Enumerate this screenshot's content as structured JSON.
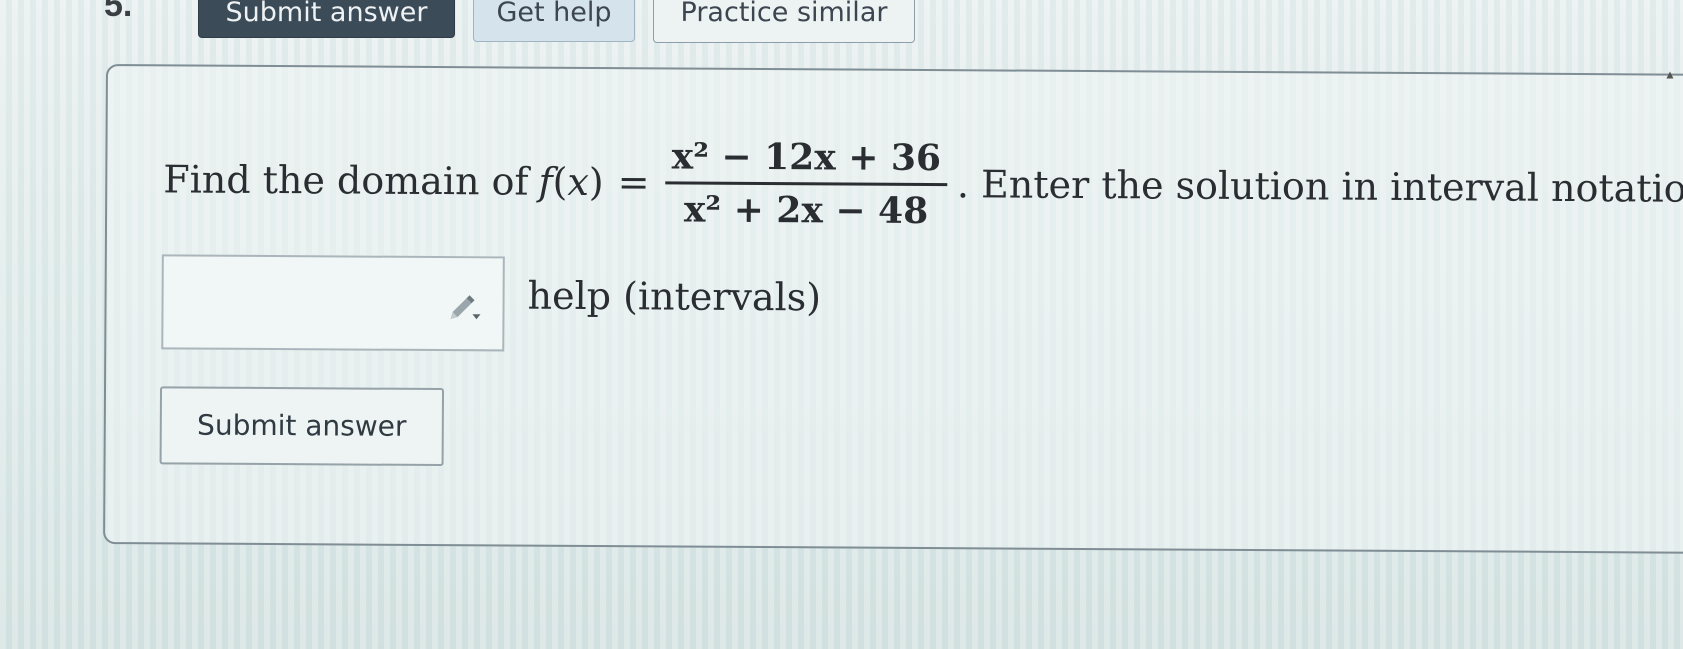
{
  "header": {
    "question_number": "5.",
    "submit_label": "Submit answer",
    "get_help_label": "Get help",
    "practice_label": "Practice similar"
  },
  "question": {
    "prefix": "Find the domain of",
    "function_name": "f",
    "variable": "x",
    "equals": "=",
    "numerator": "x² − 12x + 36",
    "denominator": "x² + 2x − 48",
    "suffix": ". Enter the solution in interval notation.",
    "answer_value": "",
    "help_text": "help (intervals)",
    "submit_label": "Submit answer"
  },
  "icons": {
    "answer_box": "pencil-icon"
  },
  "colors": {
    "primary_button": "#3c4b58",
    "secondary_button": "#d4e3ec"
  }
}
